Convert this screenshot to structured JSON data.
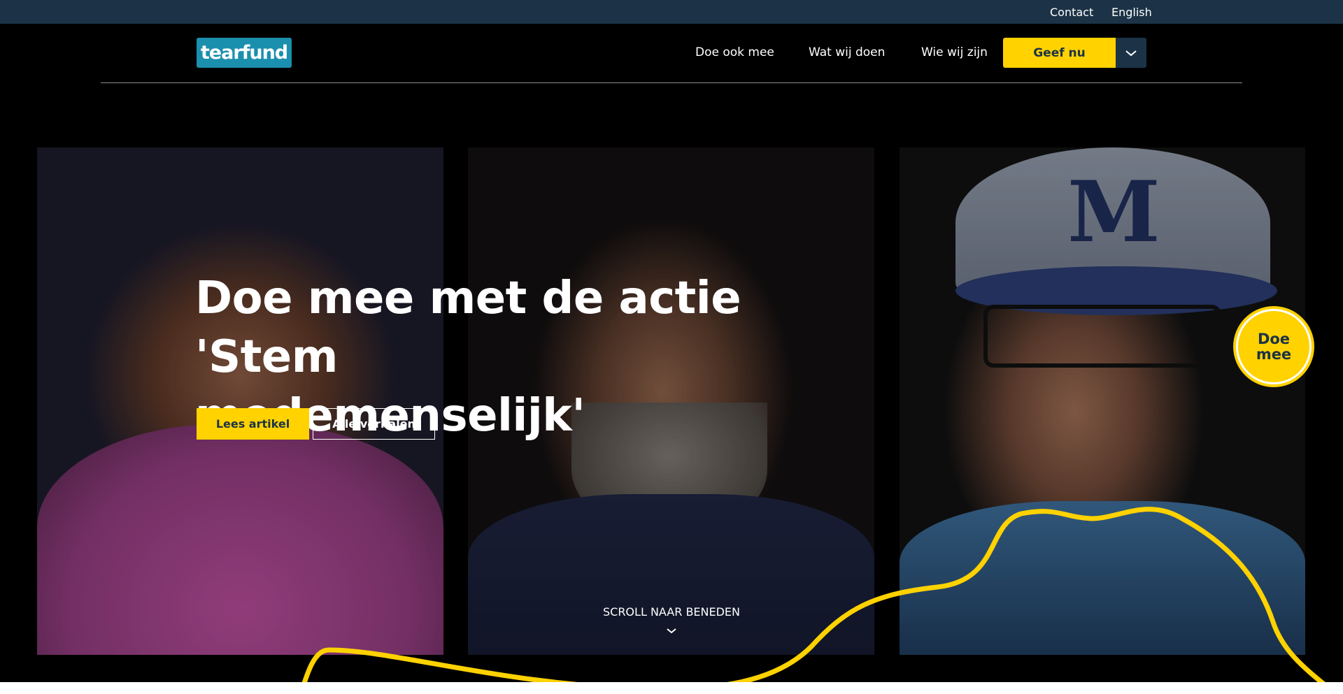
{
  "utility": {
    "contact": "Contact",
    "language": "English"
  },
  "header": {
    "logo_text": "tearfund",
    "nav": [
      "Doe ook mee",
      "Wat wij doen",
      "Wie wij zijn"
    ],
    "give_label": "Geef nu"
  },
  "hero": {
    "title_line1": "Doe mee met de actie 'Stem",
    "title_line2": "medemenselijk'",
    "read_button": "Lees artikel",
    "stories_button": "Alle verhalen",
    "join_badge": "Doe mee",
    "scroll_label": "SCROLL NAAR BENEDEN"
  },
  "colors": {
    "brand_yellow": "#ffd200",
    "brand_navy": "#1c3347",
    "logo_blue": "#1b8fae"
  }
}
